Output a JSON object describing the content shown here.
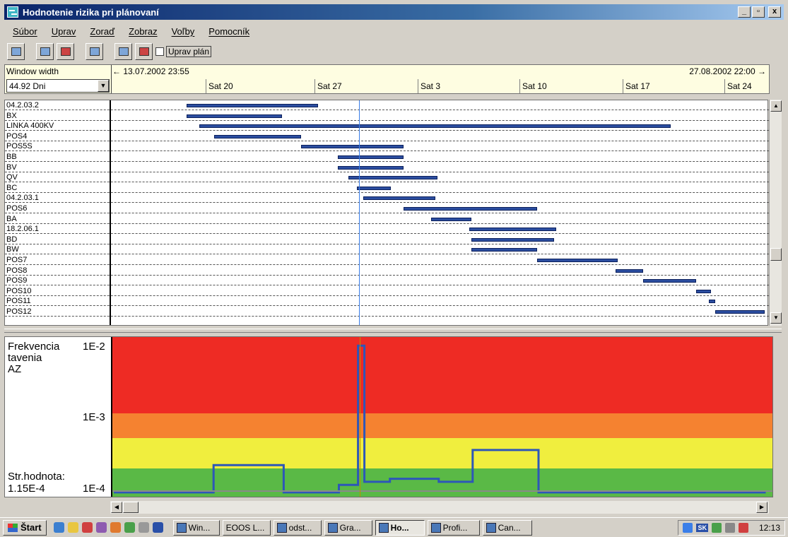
{
  "window": {
    "title": "Hodnotenie rizika pri plánovaní",
    "btn_min": "_",
    "btn_max": "▫",
    "btn_close": "x"
  },
  "menu": [
    "Súbor",
    "Uprav",
    "Zoraď",
    "Zobraz",
    "Voľby",
    "Pomocník"
  ],
  "toolbar": {
    "checkbox_label": "Uprav plán",
    "checkbox_checked": false
  },
  "timeline": {
    "window_width_label": "Window width",
    "window_width_value": "44.92 Dni",
    "start_text": "← 13.07.2002 23:55",
    "end_text": "27.08.2002 22:00 →",
    "ticks": [
      "Sat 20",
      "Sat 27",
      "Sat 3",
      "Sat 10",
      "Sat 17",
      "Sat 24"
    ]
  },
  "tasks": [
    {
      "name": "04.2.03.2",
      "start": 3.5,
      "end": 9.7
    },
    {
      "name": "BX",
      "start": 3.5,
      "end": 8.0
    },
    {
      "name": "LINKA 400KV",
      "start": 4.1,
      "end": 26.3
    },
    {
      "name": "POS4",
      "start": 4.8,
      "end": 8.9
    },
    {
      "name": "POS5S",
      "start": 8.9,
      "end": 13.7
    },
    {
      "name": "BB",
      "start": 10.6,
      "end": 13.7
    },
    {
      "name": "BV",
      "start": 10.6,
      "end": 13.7
    },
    {
      "name": "QV",
      "start": 11.1,
      "end": 15.3
    },
    {
      "name": "BC",
      "start": 11.5,
      "end": 13.1
    },
    {
      "name": "04.2.03.1",
      "start": 11.8,
      "end": 15.2
    },
    {
      "name": "POS6",
      "start": 13.7,
      "end": 20.0
    },
    {
      "name": "BA",
      "start": 15.0,
      "end": 16.9
    },
    {
      "name": "18.2.06.1",
      "start": 16.8,
      "end": 20.9
    },
    {
      "name": "BD",
      "start": 16.9,
      "end": 20.8
    },
    {
      "name": "BW",
      "start": 16.9,
      "end": 20.0
    },
    {
      "name": "POS7",
      "start": 20.0,
      "end": 23.8
    },
    {
      "name": "POS8",
      "start": 23.7,
      "end": 25.0
    },
    {
      "name": "POS9",
      "start": 25.0,
      "end": 27.5
    },
    {
      "name": "POS10",
      "start": 27.5,
      "end": 28.2
    },
    {
      "name": "POS11",
      "start": 28.1,
      "end": 28.4
    },
    {
      "name": "POS12",
      "start": 28.4,
      "end": 30.7
    }
  ],
  "risk": {
    "label_title": "Frekvencia\ntavenia\nAZ",
    "label_1e2": "1E-2",
    "label_1e3": "1E-3",
    "label_1e4": "1E-4",
    "avg_label": "Str.hodnota:",
    "avg_value": "1.15E-4",
    "zone_colors": {
      "red": "#ee2b24",
      "orange": "#f58230",
      "yellow": "#f0ee3e",
      "green": "#5ab946"
    },
    "profile": [
      {
        "t": 0.0,
        "v": 0.01
      },
      {
        "t": 4.7,
        "v": 0.01
      },
      {
        "t": 4.7,
        "v": 0.19
      },
      {
        "t": 8.0,
        "v": 0.19
      },
      {
        "t": 8.0,
        "v": 0.01
      },
      {
        "t": 10.6,
        "v": 0.01
      },
      {
        "t": 10.6,
        "v": 0.06
      },
      {
        "t": 11.5,
        "v": 0.06
      },
      {
        "t": 11.5,
        "v": 0.98
      },
      {
        "t": 11.8,
        "v": 0.98
      },
      {
        "t": 11.8,
        "v": 0.08
      },
      {
        "t": 13.0,
        "v": 0.08
      },
      {
        "t": 13.0,
        "v": 0.1
      },
      {
        "t": 15.3,
        "v": 0.1
      },
      {
        "t": 15.3,
        "v": 0.08
      },
      {
        "t": 16.9,
        "v": 0.08
      },
      {
        "t": 16.9,
        "v": 0.29
      },
      {
        "t": 20.0,
        "v": 0.29
      },
      {
        "t": 20.0,
        "v": 0.01
      },
      {
        "t": 30.7,
        "v": 0.01
      }
    ]
  },
  "taskbar": {
    "start_label": "Štart",
    "tasks": [
      "Win...",
      "EOOS L...",
      "odst...",
      "Gra...",
      "Ho...",
      "Profi...",
      "Can..."
    ],
    "active_task": "Ho...",
    "tray_lang": "SK",
    "clock": "12:13"
  }
}
